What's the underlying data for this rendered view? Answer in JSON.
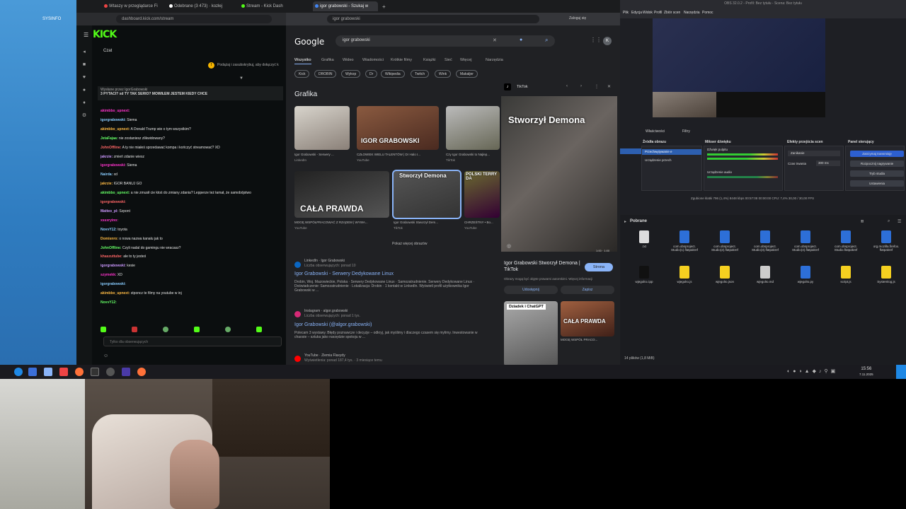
{
  "desktop": {
    "label": "SYSINFO"
  },
  "browser": {
    "tabs": [
      "Wtaszy w przeglądarce Fi",
      "Odebrane (3 473) · kozłej",
      "Stream - Kick Dash",
      "igor grabowski - Szukaj w"
    ],
    "kick_url": "dashboard.kick.com/stream",
    "google_url": "igor grabowski",
    "profile_btn": "Zaloguj się"
  },
  "kick": {
    "logo": "KICK",
    "chat_title": "Czat",
    "notice": "Podążaj i zasubskrybuj, aby dołączyć k",
    "pinned_author": "Wysłane przez IgorGrabowski",
    "pinned_text": "3 PYTACI? xd TY TAK SERIO? MOWIŁEM JESTEM KIEDY CHCE",
    "messages": [
      {
        "user": "akimbbo_upnext:",
        "text": ""
      },
      {
        "user": "igorgrabowski:",
        "text": "Siema"
      },
      {
        "user": "akimbbo_upnext:",
        "text": "A Donald Trump wie o tym wszystkim?"
      },
      {
        "user": "JetaFajaa:",
        "text": "nie zostaniesz zlikwidowany?"
      },
      {
        "user": "JohnOffline:",
        "text": "A ty nie miałeś sprzedawać kompa i kończyć streamować? XD"
      },
      {
        "user": "jakrzie:",
        "text": "zmień zdanie wiesz"
      },
      {
        "user": "igorgrabowski:",
        "text": "Siema"
      },
      {
        "user": "Nairda:",
        "text": "xd"
      },
      {
        "user": "jakrzie:",
        "text": "IGOR BANUJ GO"
      },
      {
        "user": "akimbbo_upnext:",
        "text": "a nie zmusił cie ktoś do zmiany zdania? Lepperze też łamał, że samobójstwo"
      },
      {
        "user": "igorgrabowski:",
        "text": ""
      },
      {
        "user": "Matteo_pl:",
        "text": "Szpont"
      },
      {
        "user": "xssxryino:",
        "text": ""
      },
      {
        "user": "NovvY12:",
        "text": "toyota"
      },
      {
        "user": "Domisnro:",
        "text": "o nowa nazwa kanału jak to"
      },
      {
        "user": "JohnOffline:",
        "text": "Czyli nadal do gamingu nie wracasz?"
      },
      {
        "user": "khaszuttube:",
        "text": "ale to ty jesteś"
      },
      {
        "user": "igorgrabowski:",
        "text": "kesie"
      },
      {
        "user": "szymekk:",
        "text": "XD"
      },
      {
        "user": "igorgrabowski:",
        "text": ""
      },
      {
        "user": "akimbbo_upnext:",
        "text": "stponcz te filmy na youtube w inj"
      },
      {
        "user": "NovvY12:",
        "text": ""
      }
    ],
    "input_placeholder": "Tylko dla obserwujących"
  },
  "google": {
    "logo": "Google",
    "query": "igor grabowski",
    "avatar": "K",
    "tabs": [
      "Wszystko",
      "Grafika",
      "Wideo",
      "Wiadomości",
      "Krótkie filmy",
      "Książki",
      "Sieć",
      "Więcej",
      "Narzędzia"
    ],
    "chips": [
      "Kick",
      "DROBIN",
      "Wykop",
      "Dr",
      "Wikipedia",
      "Twitch",
      "Wink",
      "Makaljer"
    ],
    "images_heading": "Grafika",
    "images": [
      {
        "caption": "Igor Grabowski - Serwery ...",
        "source": "LinkedIn",
        "overlay": ""
      },
      {
        "caption": "CZŁOWIEK WIELU TALENTÓW | Dr Halo I...",
        "source": "YouTube",
        "overlay": "IGOR GRABOWSKI"
      },
      {
        "caption": "Czy Igor Grabowski to Najlep...",
        "source": "TikTok",
        "overlay": ""
      },
      {
        "caption": "MOGĘ WSPÓŁPRACOWAĆ Z RZĄDEM | WYWA...",
        "source": "YouTube",
        "overlay": "CAŁA PRAWDA"
      },
      {
        "caption": "Igor Grabowski Stworzył Dem...",
        "source": "TikTok",
        "overlay": "Stworzył Demona"
      },
      {
        "caption": "CHRZEŚTNY • Bo...",
        "source": "YouTube",
        "overlay": "POLSKI TERRY DA"
      }
    ],
    "more_images": "Pokaż więcej obrazów",
    "results": [
      {
        "source": "LinkedIn · Igor Grabowski",
        "meta": "Liczba obserwujących: ponad 10",
        "title": "Igor Grabowski - Serwery Dedykowane Linux",
        "snippet": "Drobin, Woj. Mazowieckie, Polska · Serwery Dedykowane Linux · Samozatrudnienie. Serwery Dedykowane Linux · Doświadczenie: Samozatrudnienie · Lokalizacja: Drobin · 1 kontakt w LinkedIn. Wyświetl profil użytkownika Igor Grabowski w ..."
      },
      {
        "source": "Instagram · algor.grabowski",
        "meta": "Liczba obserwujących: ponad 1 tys.",
        "title": "Igor Grabowski (@algor.grabowski)",
        "snippet": "Polecam 3 wystawy. Błędy poznawcze i decyzje – odkryj, jak myślimy i dlaczego czasem się mylimy. Inwestowanie w chaosie – sztuka jako narzędzie spokoju w ..."
      },
      {
        "source": "YouTube · Ziemia Flaxydy",
        "meta": "Wyświetlenia: ponad 187,4 tys. · 3 miesiące temu",
        "title": "",
        "snippet": ""
      }
    ],
    "side": {
      "header": "TikTok",
      "overlay": "Stworzył Demona",
      "time": "1:00 · 1:00",
      "title": "Igor Grabowski Stworzył Demona | TikTok",
      "visit": "Strona",
      "note": "Obrazy mogą być objęte prawami autorskimi. Więcej informacji",
      "share": "Udostępnij",
      "save": "Zapisz",
      "thumb1": "Dziadek i ChatGPT",
      "thumb2": "CAŁA PRAWDA",
      "thumb2_caption": "MOGĘ WSPÓŁ PRACO..."
    }
  },
  "obs": {
    "title": "OBS 32.0.2 - Profil: Bez tytułu - Scena: Bez tytułu",
    "menu": [
      "Plik",
      "Edycja",
      "Widok",
      "Profil",
      "Zbiór scen",
      "Narzędzia",
      "Pomoc"
    ],
    "properties_btn": "Właściwości",
    "filters_btn": "Filtry",
    "docks": [
      "Źródła obrazu",
      "Mikser dźwięku",
      "Efekty przejścia scen",
      "Panel sterujący"
    ],
    "sources": [
      "Przechwytywanie e",
      "Urządzenie przech"
    ],
    "mixer": [
      "Dźwięk pulpitu",
      "Urządzenie audio"
    ],
    "transition": "Zanikanie",
    "duration_label": "Czas trwania",
    "duration": "300 ms",
    "controls": [
      "Zatrzymaj transmisję",
      "Rozpocznij nagrywanie",
      "Tryb studia",
      "Ustawienia"
    ],
    "status": "Zgubione klatki 796 (1,4%)   8448 kbps   00:57:08   00:00:00   CPU: 7,4%   30,00 / 30,00 FPS"
  },
  "files": {
    "header": "Pobrane",
    "status": "14 plików (1,8 MiB)",
    "items": [
      ".txt",
      "com.obsproject. Studio(1).flatpakref",
      "com.obsproject. Studio(2).flatpakref",
      "com.obsproject. Studio(3).flatpakref",
      "com.obsproject. Studio(4).flatpakref",
      "com.obsproject. Studio.flatpakref",
      "org.mozilla.firefox. flatpakref",
      "wjegolIo.cpp",
      "wjegolIo.js",
      "wjegolIo.json",
      "wjegolIo.md",
      "wjegolIo.py",
      "script.js",
      "Systemlog.js"
    ]
  },
  "taskbar": {
    "time": "15:56",
    "date": "7.11.2025"
  },
  "colors": {
    "kick_green": "#53fc18",
    "google_link": "#8ab4f8",
    "desktop_blue": "#2f7cc0"
  }
}
